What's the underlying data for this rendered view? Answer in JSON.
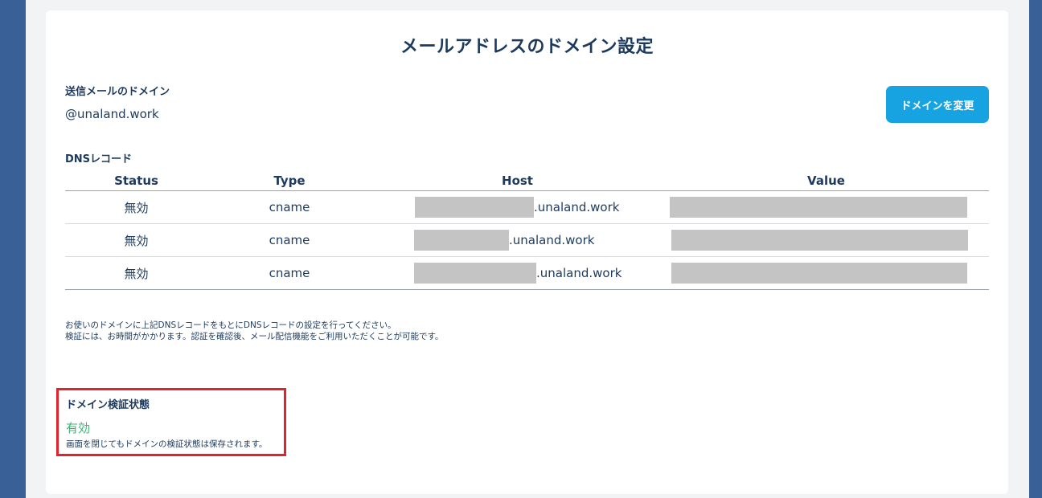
{
  "page": {
    "title": "メールアドレスのドメイン設定"
  },
  "sending_domain": {
    "label": "送信メールのドメイン",
    "value": "@unaland.work",
    "change_button": "ドメインを変更"
  },
  "dns": {
    "label": "DNSレコード",
    "columns": [
      "Status",
      "Type",
      "Host",
      "Value"
    ],
    "rows": [
      {
        "status": "無効",
        "type": "cname",
        "host_suffix": ".unaland.work"
      },
      {
        "status": "無効",
        "type": "cname",
        "host_suffix": ".unaland.work"
      },
      {
        "status": "無効",
        "type": "cname",
        "host_suffix": ".unaland.work"
      }
    ]
  },
  "notes": {
    "line1": "お使いのドメインに上記DNSレコードをもとにDNSレコードの設定を行ってください。",
    "line2": "検証には、お時間がかかります。認証を確認後、メール配信機能をご利用いただくことが可能です。"
  },
  "verification": {
    "label": "ドメイン検証状態",
    "status": "有効",
    "status_color": "#3cb371",
    "note": "画面を閉じてもドメインの検証状態は保存されます。"
  },
  "colors": {
    "accent": "#17a3e2",
    "frame": "#3a6098",
    "highlight_border": "#e0232e"
  }
}
